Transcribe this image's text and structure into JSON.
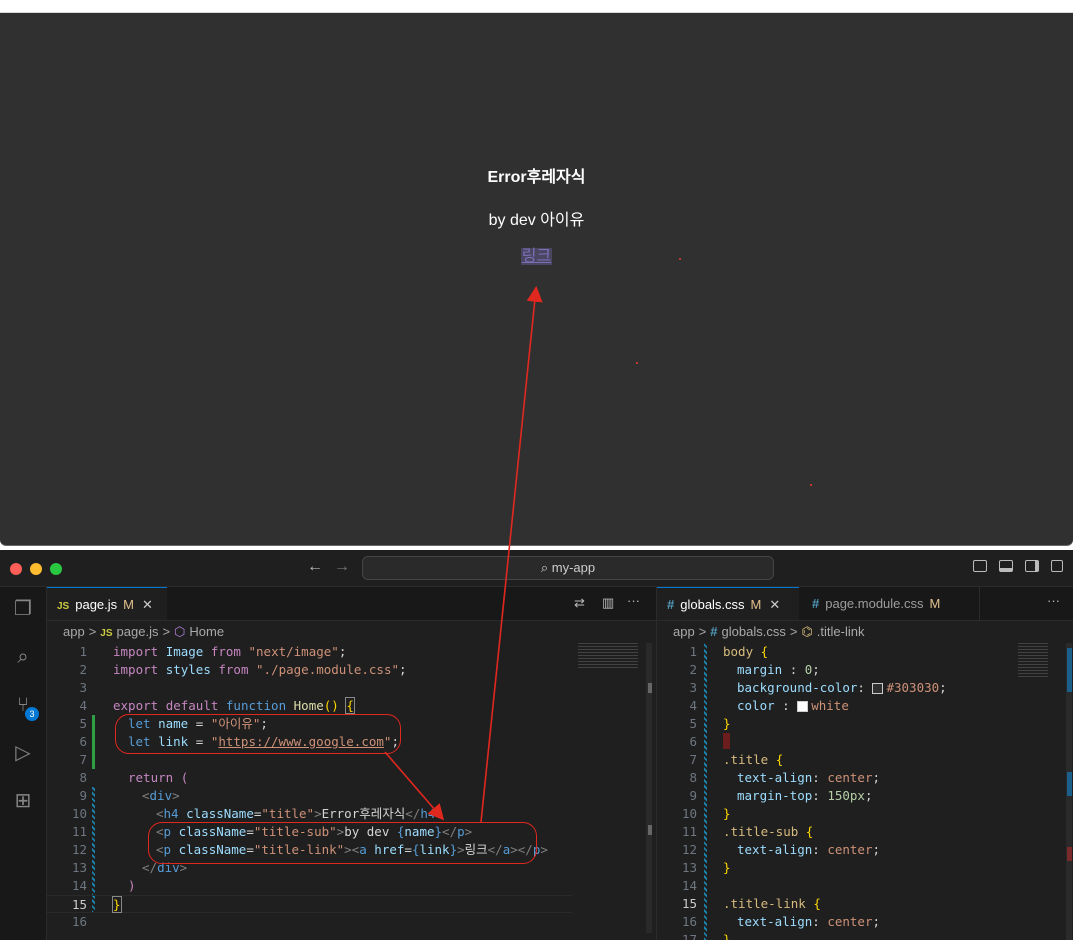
{
  "preview": {
    "title": "Error후레자식",
    "subtitle": "by dev 아이유",
    "link": "링크"
  },
  "window": {
    "search": "my-app",
    "back": "←",
    "forward": "→"
  },
  "activity_badge": "3",
  "left_editor": {
    "tab": {
      "icon": "JS",
      "label": "page.js",
      "modified": "M",
      "close": "✕"
    },
    "breadcrumb": [
      "app",
      ">",
      "JS",
      "page.js",
      ">",
      "Home"
    ],
    "current_line": 15
  },
  "right_editor": {
    "tabs": [
      {
        "icon": "#",
        "label": "globals.css",
        "modified": "M",
        "close": "✕"
      },
      {
        "icon": "#",
        "label": "page.module.css",
        "modified": "M"
      }
    ],
    "breadcrumb": [
      "app",
      ">",
      "#",
      "globals.css",
      ">",
      ".title-link"
    ],
    "current_line": 15
  },
  "colors": {
    "bg": "#303030",
    "annotation": "#e0281f",
    "accent": "#0078d4"
  }
}
